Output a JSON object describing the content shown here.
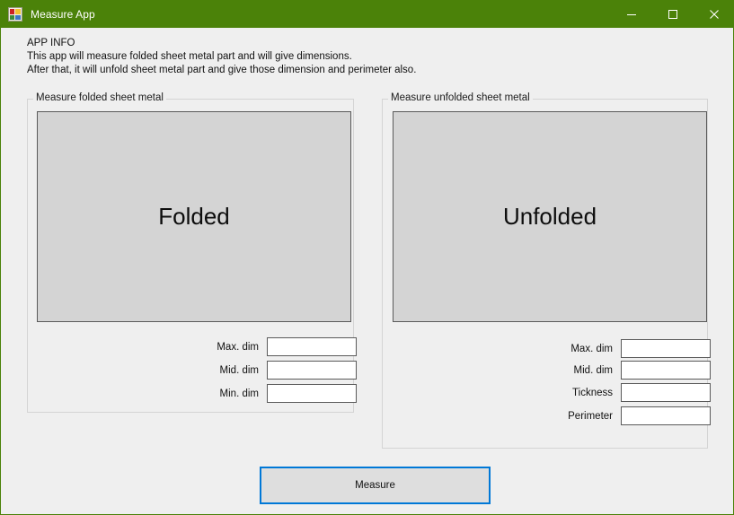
{
  "window": {
    "title": "Measure App",
    "icon": "app-window-icon",
    "accent_color": "#4b8209",
    "background_color": "#efefef",
    "controls": {
      "minimize": "minimize-icon",
      "maximize": "maximize-icon",
      "close": "close-icon"
    }
  },
  "app_info": {
    "heading": "APP INFO",
    "line1": "This app will measure folded sheet metal part and will give dimensions.",
    "line2": "After that, it will unfold sheet metal part and give those dimension and perimeter also."
  },
  "folded_group": {
    "title": "Measure folded sheet metal",
    "preview_label": "Folded",
    "fields": [
      {
        "label": "Max. dim",
        "value": "",
        "placeholder": ""
      },
      {
        "label": "Mid. dim",
        "value": "",
        "placeholder": ""
      },
      {
        "label": "Min. dim",
        "value": "",
        "placeholder": ""
      }
    ]
  },
  "unfolded_group": {
    "title": "Measure unfolded sheet metal",
    "preview_label": "Unfolded",
    "fields": [
      {
        "label": "Max. dim",
        "value": "",
        "placeholder": ""
      },
      {
        "label": "Mid. dim",
        "value": "",
        "placeholder": ""
      },
      {
        "label": "Tickness",
        "value": "",
        "placeholder": ""
      },
      {
        "label": "Perimeter",
        "value": "",
        "placeholder": ""
      }
    ]
  },
  "actions": {
    "measure_label": "Measure",
    "measure_focus_color": "#0078d7"
  }
}
